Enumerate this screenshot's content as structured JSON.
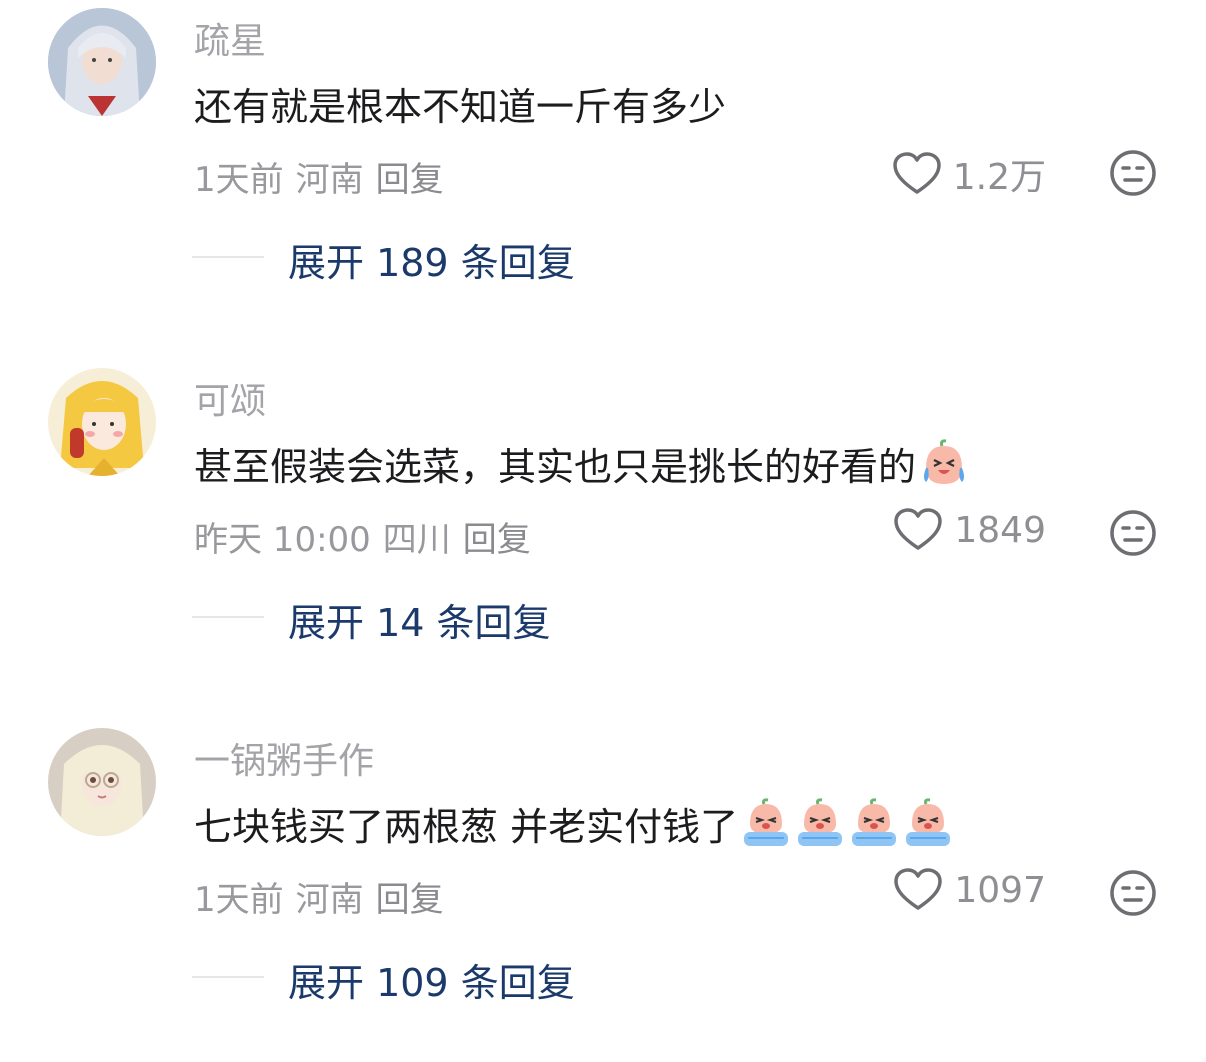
{
  "comments": [
    {
      "username": "疏星",
      "text": "还有就是根本不知道一斤有多少",
      "emojis": [],
      "time": "1天前",
      "location": "河南",
      "reply_label": "回复",
      "likes": "1.2万",
      "expand_label": "展开 189 条回复"
    },
    {
      "username": "可颂",
      "text": "甚至假装会选菜，其实也只是挑长的好看的",
      "emojis": [
        "laugh-cry-emoji"
      ],
      "time": "昨天 10:00",
      "location": "四川",
      "reply_label": "回复",
      "likes": "1849",
      "expand_label": "展开 14 条回复"
    },
    {
      "username": "一锅粥手作",
      "text": "七块钱买了两根葱 并老实付钱了",
      "emojis": [
        "crying-emoji",
        "crying-emoji",
        "crying-emoji",
        "crying-emoji"
      ],
      "time": "1天前",
      "location": "河南",
      "reply_label": "回复",
      "likes": "1097",
      "expand_label": "展开 109 条回复"
    }
  ],
  "icons": {
    "like": "heart-outline-icon",
    "dislike": "meh-face-icon"
  },
  "colors": {
    "username": "#a3a3a8",
    "text": "#1c1c1e",
    "meta": "#98989d",
    "expand": "#1b3a6b"
  }
}
